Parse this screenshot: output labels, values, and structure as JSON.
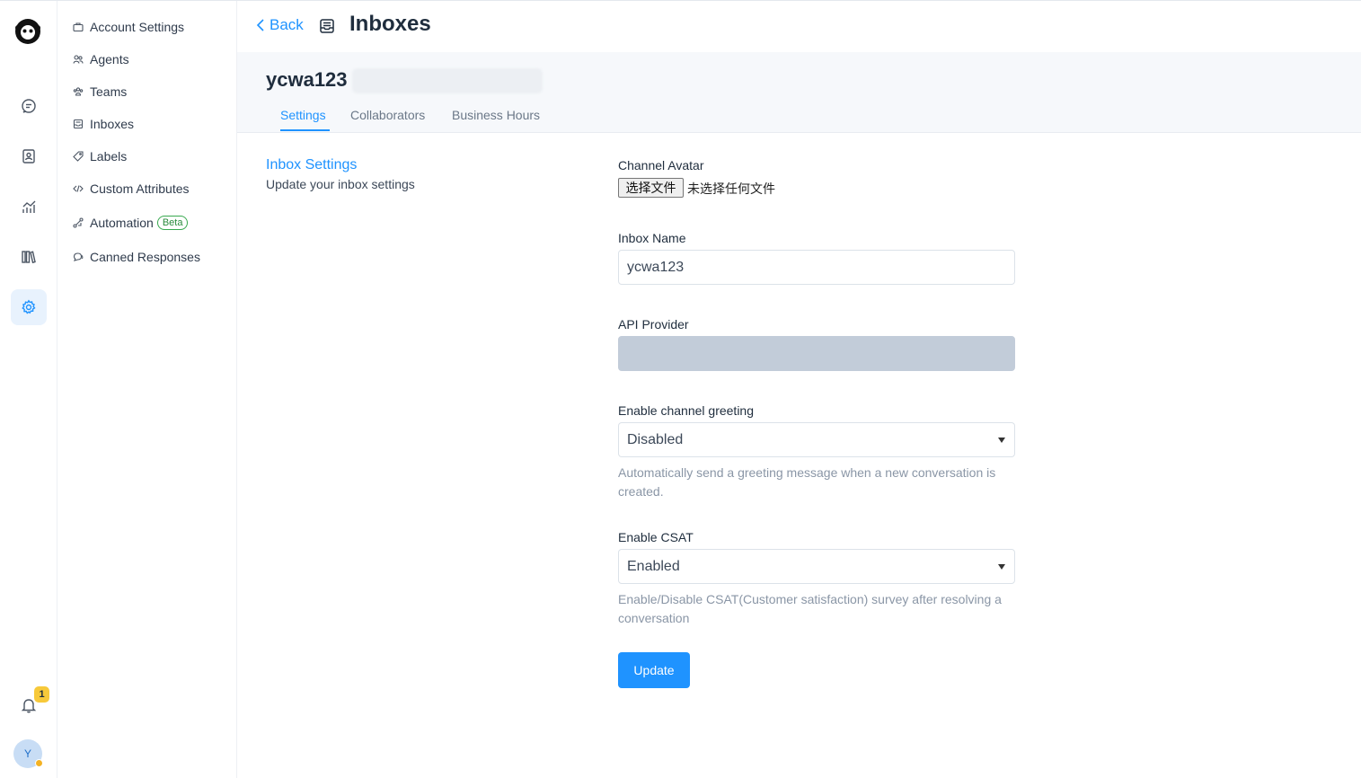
{
  "header": {
    "back_label": "Back",
    "title": "Inboxes"
  },
  "sidebar": {
    "items": [
      {
        "label": "Account Settings",
        "icon": "briefcase-icon"
      },
      {
        "label": "Agents",
        "icon": "people-icon"
      },
      {
        "label": "Teams",
        "icon": "people-team-icon"
      },
      {
        "label": "Inboxes",
        "icon": "mail-inbox-icon"
      },
      {
        "label": "Labels",
        "icon": "tag-icon"
      },
      {
        "label": "Custom Attributes",
        "icon": "code-icon"
      },
      {
        "label": "Automation",
        "icon": "automation-icon",
        "badge": "Beta"
      },
      {
        "label": "Canned Responses",
        "icon": "chat-multiple-icon"
      }
    ]
  },
  "rail": {
    "icons": [
      "logo-icon",
      "conversations-icon",
      "contacts-icon",
      "reports-icon",
      "library-icon",
      "settings-icon",
      "notifications-icon"
    ],
    "notification_count": "1",
    "avatar_initial": "Y",
    "accent": "#1f93ff"
  },
  "inbox": {
    "name": "ycwa123",
    "tabs": [
      {
        "label": "Settings",
        "active": true
      },
      {
        "label": "Collaborators",
        "active": false
      },
      {
        "label": "Business Hours",
        "active": false
      }
    ]
  },
  "section": {
    "title": "Inbox Settings",
    "description": "Update your inbox settings"
  },
  "form": {
    "avatar_label": "Channel Avatar",
    "file_button": "选择文件",
    "file_status": "未选择任何文件",
    "inbox_name_label": "Inbox Name",
    "inbox_name_value": "ycwa123",
    "api_provider_label": "API Provider",
    "api_provider_value": "",
    "greeting_label": "Enable channel greeting",
    "greeting_value": "Disabled",
    "greeting_help": "Automatically send a greeting message when a new conversation is created.",
    "csat_label": "Enable CSAT",
    "csat_value": "Enabled",
    "csat_help": "Enable/Disable CSAT(Customer satisfaction) survey after resolving a conversation",
    "update_button": "Update"
  }
}
